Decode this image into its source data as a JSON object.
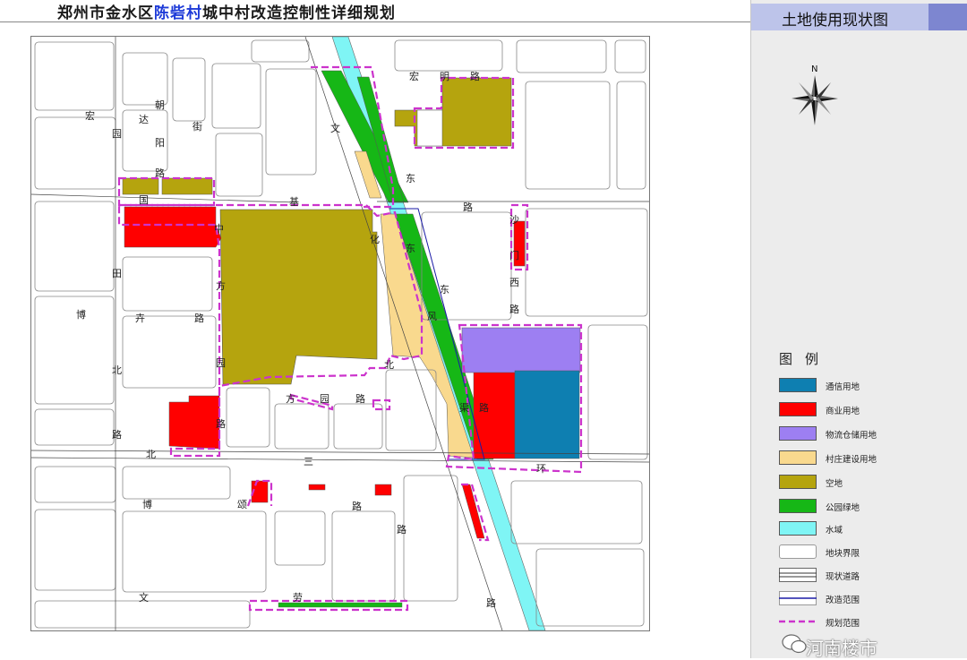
{
  "header": {
    "title_part1": "郑州市金水区",
    "title_highlight": "陈砦村",
    "title_part2": "城中村改造控制性详细规划"
  },
  "panel": {
    "title": "土地使用现状图",
    "compass_label": "N"
  },
  "legend": {
    "title": "图例",
    "items": [
      {
        "label": "通信用地",
        "color": "#0e7fb1"
      },
      {
        "label": "商业用地",
        "color": "#ff0000"
      },
      {
        "label": "物流仓储用地",
        "color": "#9d7ff2"
      },
      {
        "label": "村庄建设用地",
        "color": "#f9d98e"
      },
      {
        "label": "空地",
        "color": "#b5a40e"
      },
      {
        "label": "公园绿地",
        "color": "#16b716"
      },
      {
        "label": "水域",
        "color": "#7ff5f5"
      },
      {
        "label": "地块界限",
        "color": "#999999"
      },
      {
        "label": "现状道路",
        "color": "#333333"
      },
      {
        "label": "改造范围",
        "color": "#1a1aa6"
      },
      {
        "label": "规划范围",
        "color": "#cc33cc"
      }
    ]
  },
  "map_labels": {
    "hong": "宏",
    "yuan": "园",
    "da": "达",
    "chao": "朝",
    "yang": "阳",
    "jie": "街",
    "lu1": "路",
    "guo": "国",
    "zhong": "中",
    "tian": "田",
    "fang": "方",
    "bo": "博",
    "qi": "卉",
    "lu2": "路",
    "bei1": "北",
    "yuan2": "园",
    "lu3": "路",
    "lu4": "路",
    "bei2": "北",
    "wen": "文",
    "ji": "基",
    "hua": "化",
    "dong1": "东",
    "dong2": "东",
    "feng": "风",
    "bei3": "北",
    "qu": "渠",
    "lu5": "路",
    "hongming1": "宏",
    "hongming2": "明",
    "hongming3": "路",
    "dong3": "东",
    "lu6": "路",
    "sha": "沙",
    "men": "门",
    "xi": "西",
    "lu7": "路",
    "fang2": "方",
    "yuan3": "园",
    "lu8": "路",
    "san": "三",
    "huan": "环",
    "bo2": "博",
    "song": "颂",
    "lu9": "路",
    "lu10": "路",
    "wen2": "文",
    "lao": "劳",
    "lu11": "路"
  },
  "watermark": "河南楼市"
}
